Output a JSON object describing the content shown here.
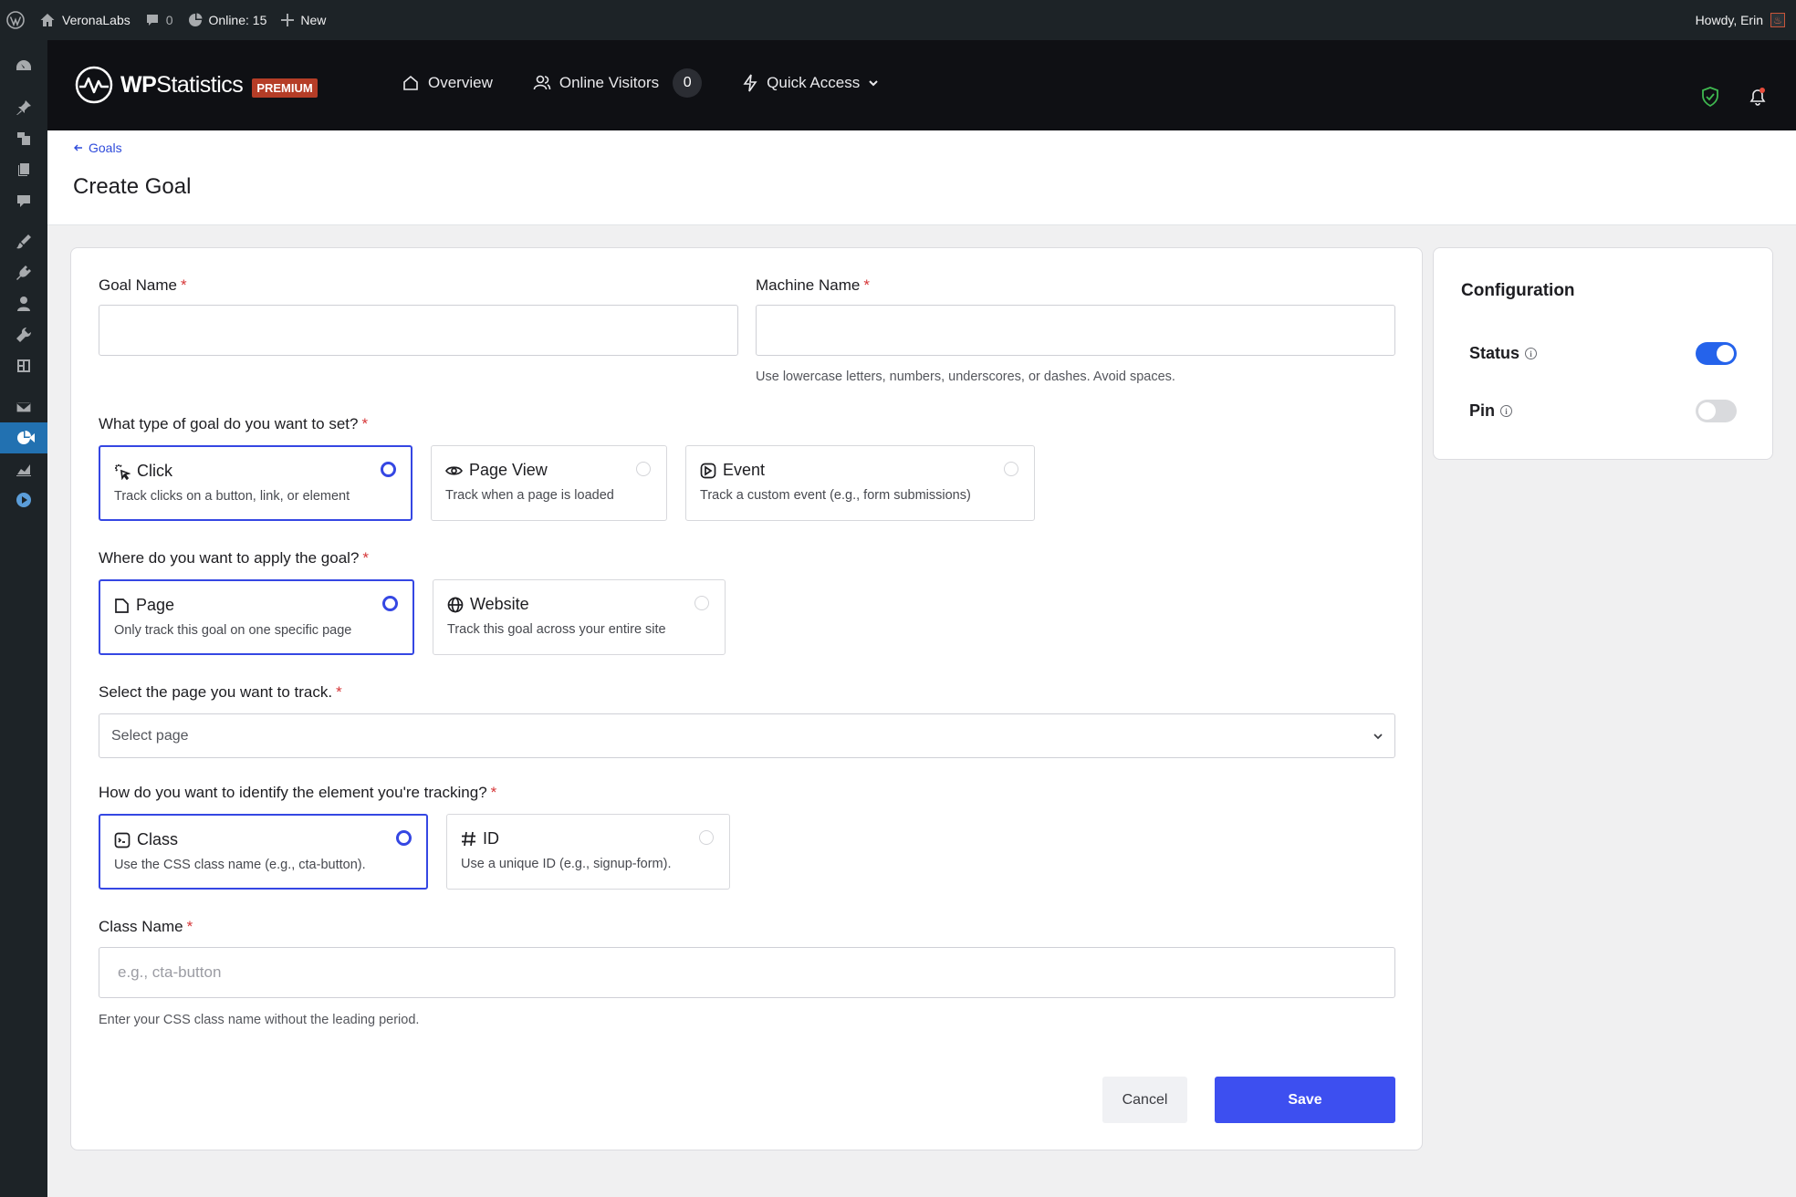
{
  "adminbar": {
    "site_name": "VeronaLabs",
    "comments_count": "0",
    "online": "Online: 15",
    "new_label": "New",
    "greeting": "Howdy, Erin"
  },
  "header": {
    "brand_wp": "WP",
    "brand_statistics": "Statistics",
    "premium_badge": "PREMIUM",
    "nav": {
      "overview": "Overview",
      "online_visitors": "Online Visitors",
      "online_visitors_count": "0",
      "quick_access": "Quick Access"
    }
  },
  "page": {
    "breadcrumb": "Goals",
    "title": "Create Goal"
  },
  "form": {
    "goal_name_label": "Goal Name",
    "goal_name_value": "",
    "machine_name_label": "Machine Name",
    "machine_name_value": "",
    "machine_name_help": "Use lowercase letters, numbers, underscores, or dashes. Avoid spaces.",
    "goal_type_question": "What type of goal do you want to set?",
    "goal_types": [
      {
        "title": "Click",
        "desc": "Track clicks on a button, link, or element",
        "selected": true
      },
      {
        "title": "Page View",
        "desc": "Track when a page is loaded",
        "selected": false
      },
      {
        "title": "Event",
        "desc": "Track a custom event (e.g., form submissions)",
        "selected": false
      }
    ],
    "apply_question": "Where do you want to apply the goal?",
    "apply_options": [
      {
        "title": "Page",
        "desc": "Only track this goal on one specific page",
        "selected": true
      },
      {
        "title": "Website",
        "desc": "Track this goal across your entire site",
        "selected": false
      }
    ],
    "select_page_question": "Select the page you want to track.",
    "select_page_value": "Select page",
    "identify_question": "How do you want to identify the element you're tracking?",
    "identify_options": [
      {
        "title": "Class",
        "desc": "Use the CSS class name (e.g., cta-button).",
        "selected": true
      },
      {
        "title": "ID",
        "desc": "Use a unique ID (e.g., signup-form).",
        "selected": false
      }
    ],
    "class_name_label": "Class Name",
    "class_name_placeholder": "e.g., cta-button",
    "class_name_help": "Enter your CSS class name without the leading period.",
    "required_mark": "*",
    "cancel_label": "Cancel",
    "save_label": "Save"
  },
  "config": {
    "title": "Configuration",
    "status_label": "Status",
    "status_on": true,
    "pin_label": "Pin",
    "pin_on": false,
    "info_glyph": "i"
  },
  "colors": {
    "accent": "#3547e3",
    "save_button": "#3d4ff0",
    "toggle_on": "#2563eb",
    "premium": "#b53d27",
    "required": "#d63638",
    "wp_admin_active": "#2271b1"
  }
}
